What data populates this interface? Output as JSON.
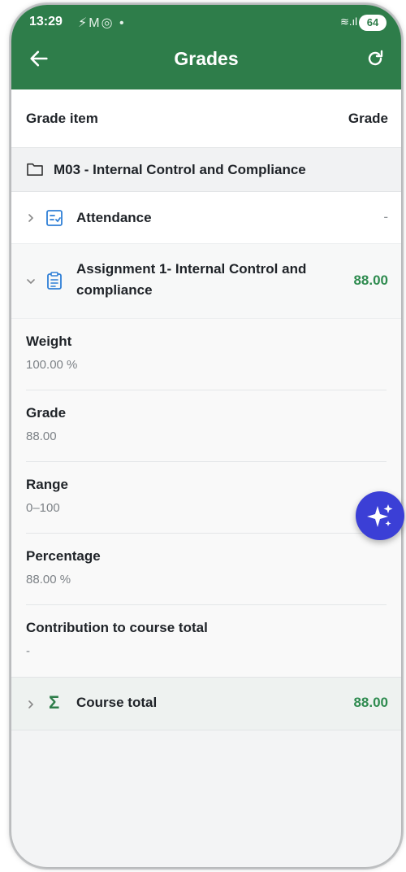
{
  "status_bar": {
    "time": "13:29",
    "notifications": "⚡M◎ •",
    "signal": "≋.ıl",
    "battery": "64"
  },
  "appbar": {
    "title": "Grades",
    "back_icon": "arrow-left-icon",
    "refresh_icon": "refresh-icon",
    "color": "#2e7d4a"
  },
  "table_header": {
    "item_label": "Grade item",
    "grade_label": "Grade"
  },
  "category": {
    "name": "M03 - Internal Control and Compliance",
    "icon": "folder-icon"
  },
  "items": [
    {
      "name": "Attendance",
      "grade": "-",
      "expanded": false,
      "icon": "attendance-icon"
    },
    {
      "name_line1": "Assignment 1- Internal Control and",
      "name_line2": "compliance",
      "grade": "88.00",
      "expanded": true,
      "icon": "assignment-icon"
    }
  ],
  "details": [
    {
      "label": "Weight",
      "value": "100.00 %"
    },
    {
      "label": "Grade",
      "value": "88.00"
    },
    {
      "label": "Range",
      "value": "0–100"
    },
    {
      "label": "Percentage",
      "value": "88.00 %"
    },
    {
      "label": "Contribution to course total",
      "value": "-"
    }
  ],
  "course_total": {
    "name": "Course total",
    "grade": "88.00",
    "icon": "sigma-icon"
  },
  "fab": {
    "icon": "sparkle-ai-icon",
    "color": "#3b3fd6"
  },
  "accent_green": "#2e8b4f"
}
